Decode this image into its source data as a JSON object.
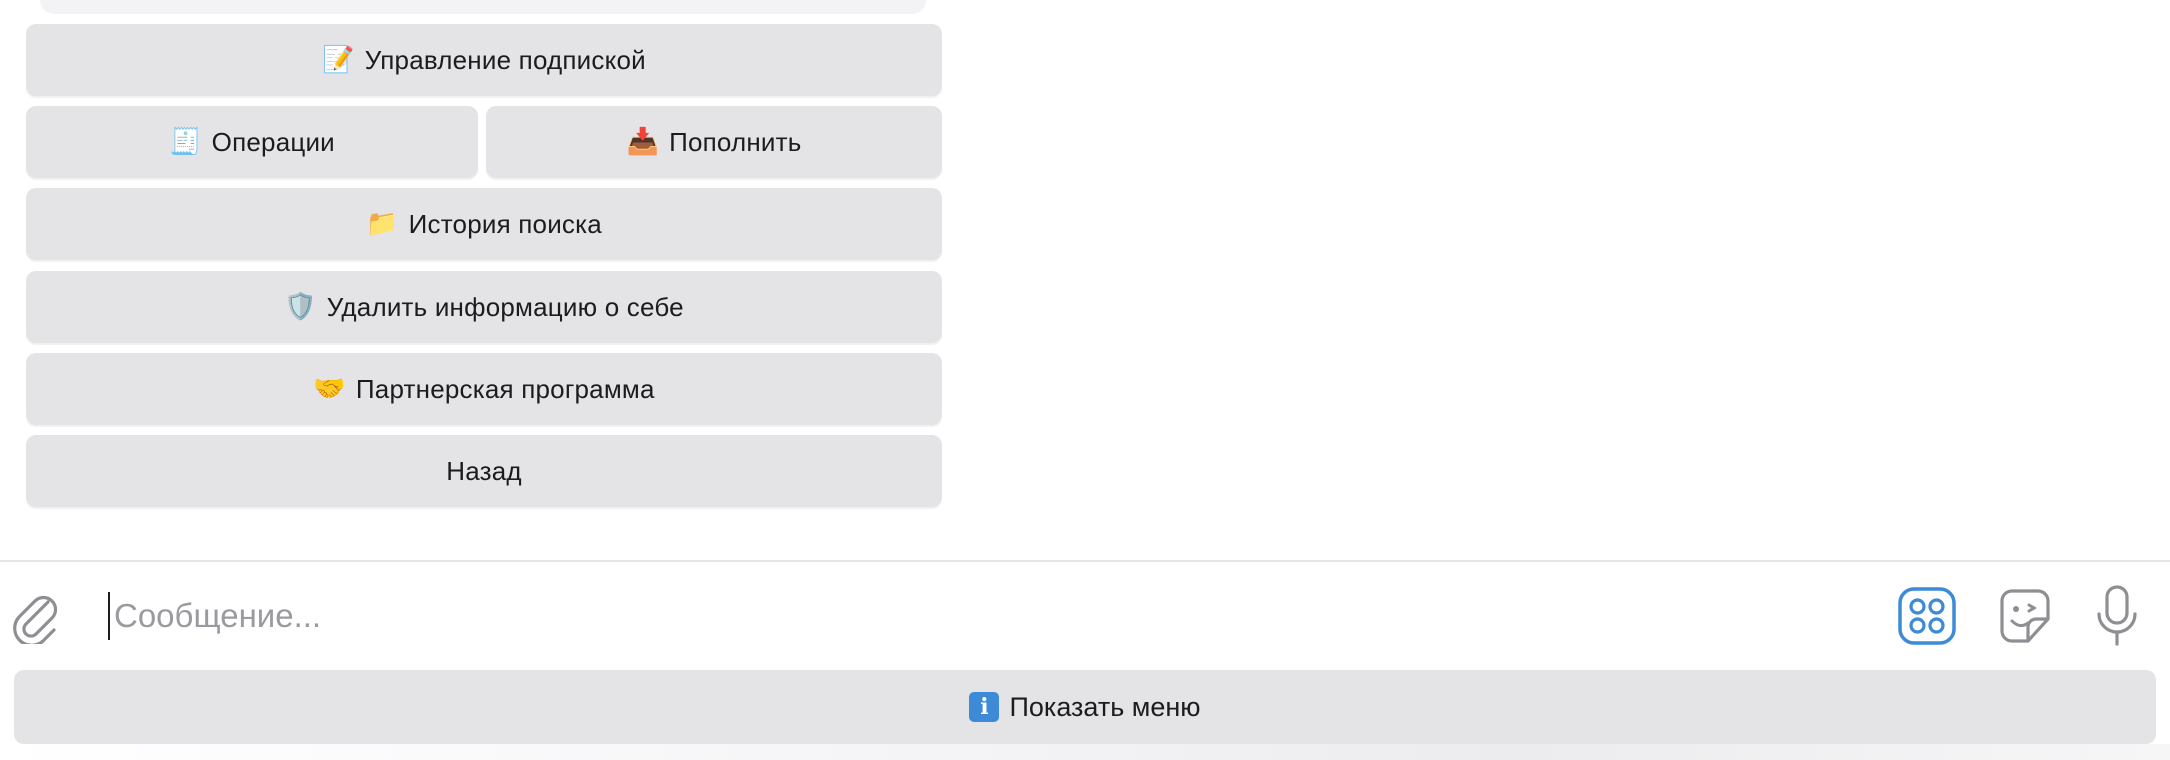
{
  "keyboard": {
    "rows": [
      [
        {
          "emoji": "📝",
          "label": "Управление подпиской"
        }
      ],
      [
        {
          "emoji": "🧾",
          "label": "Операции"
        },
        {
          "emoji": "📥",
          "label": "Пополнить"
        }
      ],
      [
        {
          "emoji": "📁",
          "label": "История поиска"
        }
      ],
      [
        {
          "emoji": "🛡️",
          "label": "Удалить информацию о себе"
        }
      ],
      [
        {
          "emoji": "🤝",
          "label": "Партнерская программа"
        }
      ],
      [
        {
          "emoji": "",
          "label": "Назад"
        }
      ]
    ]
  },
  "composer": {
    "placeholder": "Сообщение...",
    "value": ""
  },
  "icons": {
    "attach": "paperclip-icon",
    "commands": "bot-commands-icon",
    "sticker": "sticker-icon",
    "mic": "microphone-icon"
  },
  "menu_button": {
    "badge": "i",
    "label": "Показать меню"
  },
  "colors": {
    "button_bg": "#e4e4e6",
    "accent": "#3d8bd6",
    "icon_gray": "#8e8e93"
  }
}
